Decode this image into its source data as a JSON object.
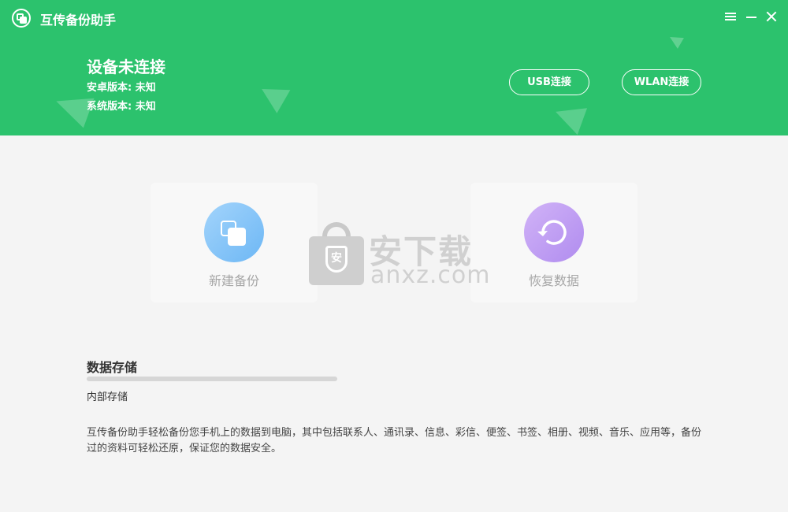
{
  "app": {
    "title": "互传备份助手"
  },
  "window_controls": {
    "menu_icon": "menu-icon",
    "minimize_icon": "minimize-icon",
    "close_icon": "close-icon"
  },
  "device": {
    "status": "设备未连接",
    "android_version": "安卓版本: 未知",
    "system_version": "系统版本: 未知"
  },
  "connect": {
    "usb_label": "USB连接",
    "wlan_label": "WLAN连接"
  },
  "cards": {
    "backup": {
      "label": "新建备份",
      "icon": "copy-icon"
    },
    "restore": {
      "label": "恢复数据",
      "icon": "restore-icon"
    }
  },
  "watermark": {
    "text_cn": "安下载",
    "text_en": "anxz.com",
    "badge": "安"
  },
  "storage": {
    "title": "数据存储",
    "label": "内部存储",
    "used_fraction": 0
  },
  "description": "互传备份助手轻松备份您手机上的数据到电脑，其中包括联系人、通讯录、信息、彩信、便签、书签、相册、视频、音乐、应用等，备份过的资料可轻松还原，保证您的数据安全。",
  "colors": {
    "header": "#2cc26d",
    "background": "#f4f4f4",
    "backup_icon": "#7fbff7",
    "restore_icon": "#bb98f0"
  }
}
